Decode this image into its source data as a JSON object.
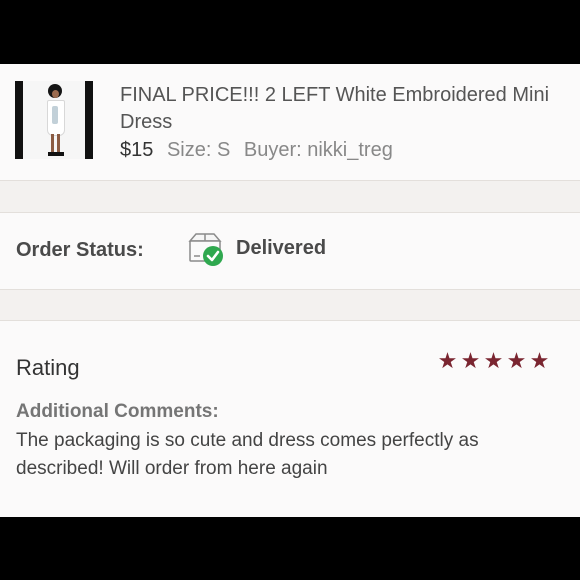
{
  "product": {
    "title": "FINAL PRICE!!! 2 LEFT White Embroidered Mini Dress",
    "price": "$15",
    "size": "Size: S",
    "buyer": "Buyer: nikki_treg"
  },
  "order": {
    "label": "Order Status:",
    "status": "Delivered",
    "status_icon": "package-delivered-icon",
    "status_color": "#2fa84f"
  },
  "review": {
    "rating_label": "Rating",
    "stars": 5,
    "star_color": "#7a2530",
    "comments_label": "Additional Comments:",
    "comments": "The packaging is so cute and dress comes perfectly as described! Will order from here again"
  }
}
